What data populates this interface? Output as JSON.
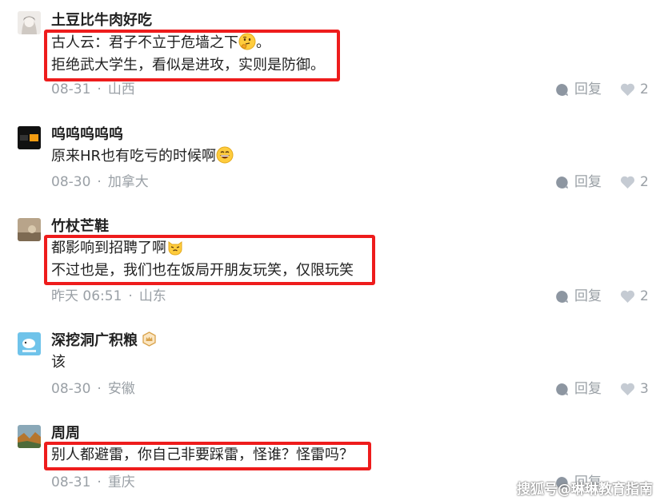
{
  "comments": [
    {
      "username": "土豆比牛肉好吃",
      "lines": [
        "古人云：君子不立于危墙之下",
        "拒绝武大学生，看似是进攻，实则是防御。"
      ],
      "line1_suffix": "。",
      "emoji": "thinking-face-icon",
      "date": "08-31",
      "location": "山西",
      "reply_label": "回复",
      "likes": "2"
    },
    {
      "username": "呜呜呜呜呜",
      "lines": [
        "原来HR也有吃亏的时候啊"
      ],
      "emoji": "grinning-face-icon",
      "date": "08-30",
      "location": "加拿大",
      "reply_label": "回复",
      "likes": "2"
    },
    {
      "username": "竹杖芒鞋",
      "lines": [
        "都影响到招聘了啊",
        "不过也是，我们也在饭局开朋友玩笑，仅限玩笑"
      ],
      "emoji": "cat-face-icon",
      "date": "昨天 06:51",
      "location": "山东",
      "reply_label": "回复",
      "likes": "2"
    },
    {
      "username": "深挖洞广积粮",
      "lines": [
        "该"
      ],
      "date": "08-30",
      "location": "安徽",
      "reply_label": "回复",
      "likes": "3"
    },
    {
      "username": "周周",
      "lines": [
        "别人都避雷，你自己非要踩雷，怪谁？怪雷吗？"
      ],
      "date": "08-31",
      "location": "重庆",
      "reply_label": "回复",
      "likes": ""
    }
  ],
  "meta_separator": "·",
  "watermark": "搜狐号@琳琳教育指南",
  "colors": {
    "highlight": "#ee1c1c",
    "meta": "#9aa0a6",
    "text": "#222222"
  }
}
